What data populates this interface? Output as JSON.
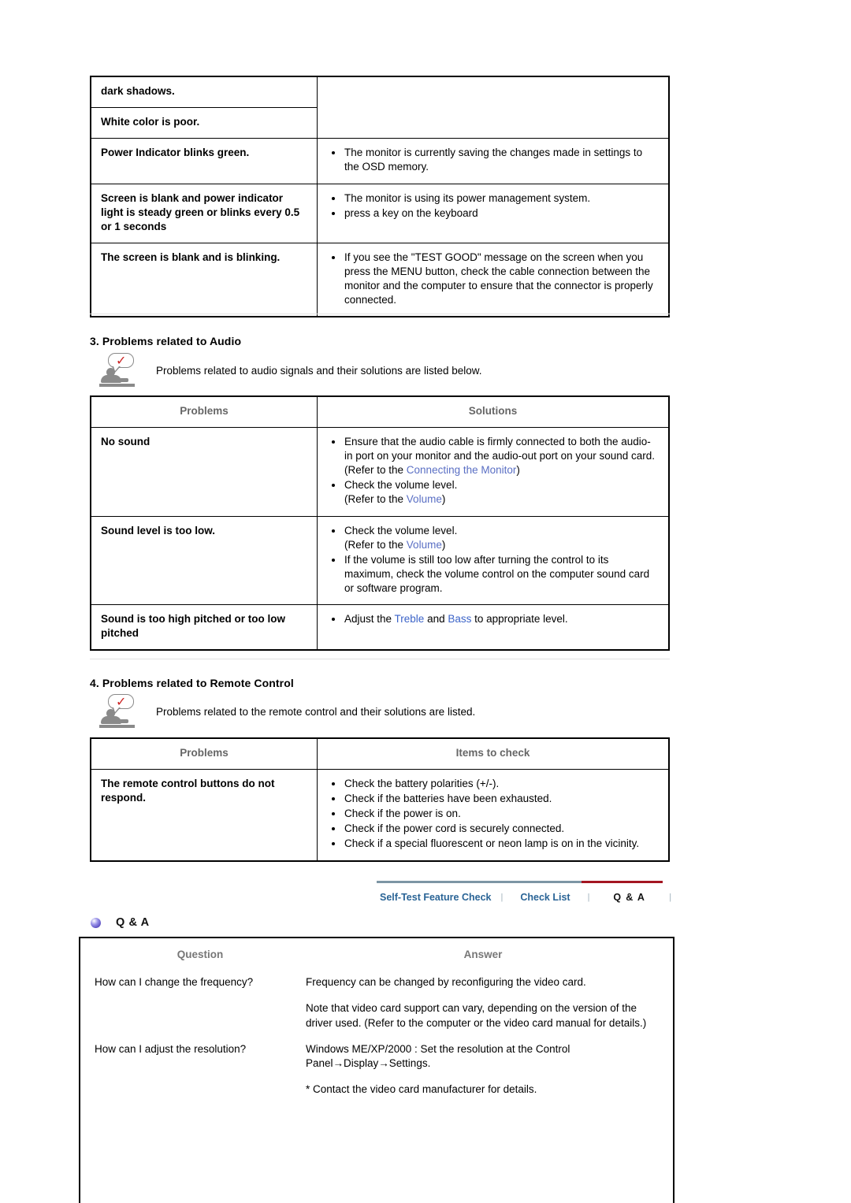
{
  "video_table": {
    "rows": [
      {
        "problem": "dark shadows.",
        "solutions": []
      },
      {
        "problem": "White color is poor.",
        "solutions": []
      },
      {
        "problem": "Power Indicator blinks green.",
        "solutions": [
          "The monitor is currently saving the changes made in settings to the OSD memory."
        ]
      },
      {
        "problem": "Screen is blank and power indicator light is steady green or blinks every 0.5 or 1 seconds",
        "solutions": [
          "The monitor is using its power management system.",
          "press a key on the keyboard"
        ]
      },
      {
        "problem": "The screen is blank and is blinking.",
        "solutions": [
          "If you see the \"TEST GOOD\" message on the screen when you press the MENU button, check the cable connection between the monitor and the computer to ensure that the connector is properly connected."
        ]
      }
    ]
  },
  "audio_section": {
    "heading": "3. Problems related to Audio",
    "note": "Problems related to audio signals and their solutions are listed below.",
    "icon": "person-check-icon",
    "headers": {
      "problems": "Problems",
      "solutions": "Solutions"
    },
    "rows": [
      {
        "problem": "No sound",
        "items": [
          {
            "text": "Ensure that the audio cable is firmly connected to both the audio-in port on your monitor and the audio-out port on your sound card.",
            "sub_prefix": "(Refer to the ",
            "sub_link": "Connecting the Monitor",
            "sub_suffix": ")"
          },
          {
            "text": "Check the volume level.",
            "sub_prefix": "(Refer to the ",
            "sub_link": "Volume",
            "sub_suffix": ")"
          }
        ]
      },
      {
        "problem": "Sound level is too low.",
        "items": [
          {
            "text": "Check the volume level.",
            "sub_prefix": "(Refer to the ",
            "sub_link": "Volume",
            "sub_suffix": ")"
          },
          {
            "text": "If the volume is still too low after turning the control to its maximum, check the volume control on the computer sound card or software program."
          }
        ]
      },
      {
        "problem": "Sound is too high pitched or too low pitched",
        "items": [
          {
            "rich": true,
            "parts": [
              {
                "t": "Adjust the ",
                "link": false
              },
              {
                "t": "Treble",
                "link": true
              },
              {
                "t": " and ",
                "link": false
              },
              {
                "t": "Bass",
                "link": true
              },
              {
                "t": " to appropriate level.",
                "link": false
              }
            ]
          }
        ]
      }
    ]
  },
  "remote_section": {
    "heading": "4. Problems related to Remote Control",
    "note": "Problems related to the remote control and their solutions are listed.",
    "icon": "person-check-icon",
    "headers": {
      "problems": "Problems",
      "items": "Items to check"
    },
    "rows": [
      {
        "problem": "The remote control buttons do not respond.",
        "items": [
          "Check the battery polarities (+/-).",
          "Check if the batteries have been exhausted.",
          "Check if the power is on.",
          "Check if the power cord is securely connected.",
          "Check if a special fluorescent or neon lamp is on in the vicinity."
        ]
      }
    ]
  },
  "nav": {
    "tabs": [
      {
        "label": "Self-Test Feature Check",
        "active": false
      },
      {
        "label": "Check List",
        "active": false
      },
      {
        "label": "Q & A",
        "active": true
      }
    ],
    "separator": "|",
    "inactive_color": "#2a6496",
    "active_underline_color": "#a31621",
    "inactive_underline_color": "#7d96a4"
  },
  "qa_section": {
    "bullet_icon": "blue-orb-bullet-icon",
    "title": "Q & A",
    "headers": {
      "question": "Question",
      "answer": "Answer"
    },
    "rows": [
      {
        "question": "How can I change the frequency?",
        "answers": [
          "Frequency can be changed by reconfiguring the video card.",
          "Note that video card support can vary, depending on the version of the driver used. (Refer to the computer or the video card manual for details.)"
        ]
      },
      {
        "question": "How can I adjust the resolution?",
        "answers": [
          "Windows ME/XP/2000 : Set the resolution at the Control Panel→Display→Settings.",
          "* Contact the video card manufacturer for details."
        ]
      }
    ]
  }
}
